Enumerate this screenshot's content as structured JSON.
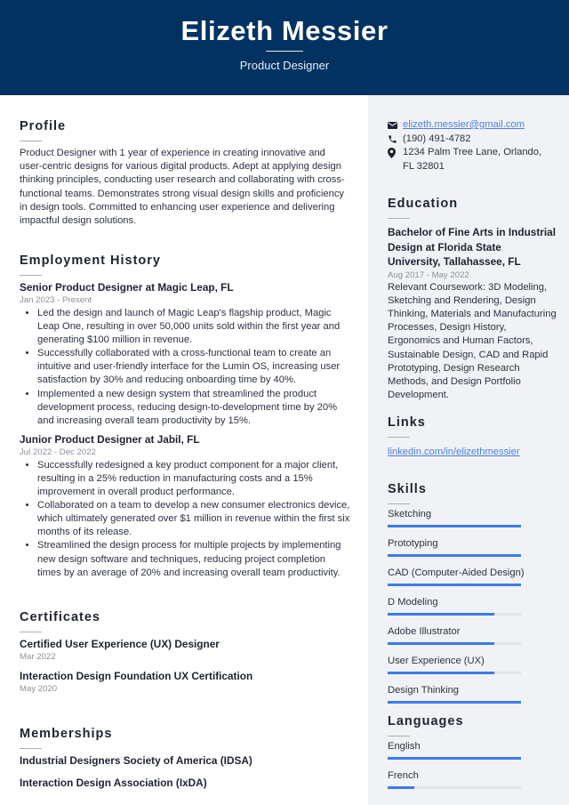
{
  "header": {
    "name": "Elizeth Messier",
    "title": "Product Designer"
  },
  "profile": {
    "heading": "Profile",
    "text": "Product Designer with 1 year of experience in creating innovative and user-centric designs for various digital products. Adept at applying design thinking principles, conducting user research and collaborating with cross-functional teams. Demonstrates strong visual design skills and proficiency in design tools. Committed to enhancing user experience and delivering impactful design solutions."
  },
  "employment": {
    "heading": "Employment History",
    "jobs": [
      {
        "title": "Senior Product Designer at Magic Leap, FL",
        "dates": "Jan 2023 - Present",
        "bullets": [
          "Led the design and launch of Magic Leap's flagship product, Magic Leap One, resulting in over 50,000 units sold within the first year and generating $100 million in revenue.",
          "Successfully collaborated with a cross-functional team to create an intuitive and user-friendly interface for the Lumin OS, increasing user satisfaction by 30% and reducing onboarding time by 40%.",
          "Implemented a new design system that streamlined the product development process, reducing design-to-development time by 20% and increasing overall team productivity by 15%."
        ]
      },
      {
        "title": "Junior Product Designer at Jabil, FL",
        "dates": "Jul 2022 - Dec 2022",
        "bullets": [
          "Successfully redesigned a key product component for a major client, resulting in a 25% reduction in manufacturing costs and a 15% improvement in overall product performance.",
          "Collaborated on a team to develop a new consumer electronics device, which ultimately generated over $1 million in revenue within the first six months of its release.",
          "Streamlined the design process for multiple projects by implementing new design software and techniques, reducing project completion times by an average of 20% and increasing overall team productivity."
        ]
      }
    ]
  },
  "certificates": {
    "heading": "Certificates",
    "items": [
      {
        "name": "Certified User Experience (UX) Designer",
        "date": "Mar 2022"
      },
      {
        "name": "Interaction Design Foundation UX Certification",
        "date": "May 2020"
      }
    ]
  },
  "memberships": {
    "heading": "Memberships",
    "items": [
      "Industrial Designers Society of America (IDSA)",
      "Interaction Design Association (IxDA)"
    ]
  },
  "contact": {
    "email": "elizeth.messier@gmail.com",
    "phone": "(190) 491-4782",
    "address": "1234 Palm Tree Lane, Orlando, FL 32801",
    "icons": {
      "email": "envelope-icon",
      "phone": "phone-icon",
      "address": "map-pin-icon"
    }
  },
  "education": {
    "heading": "Education",
    "degree": "Bachelor of Fine Arts in Industrial Design at Florida State University, Tallahassee, FL",
    "dates": "Aug 2017 - May 2022",
    "description": "Relevant Coursework: 3D Modeling, Sketching and Rendering, Design Thinking, Materials and Manufacturing Processes, Design History, Ergonomics and Human Factors, Sustainable Design, CAD and Rapid Prototyping, Design Research Methods, and Design Portfolio Development."
  },
  "links": {
    "heading": "Links",
    "items": [
      "linkedin.com/in/elizethmessier"
    ]
  },
  "skills": {
    "heading": "Skills",
    "items": [
      {
        "name": "Sketching",
        "level": 1.0
      },
      {
        "name": "Prototyping",
        "level": 1.0
      },
      {
        "name": "CAD (Computer-Aided Design)",
        "level": 1.0
      },
      {
        "name": "D Modeling",
        "level": 0.8
      },
      {
        "name": "Adobe Illustrator",
        "level": 0.8
      },
      {
        "name": "User Experience (UX)",
        "level": 0.8
      },
      {
        "name": "Design Thinking",
        "level": 1.0
      }
    ]
  },
  "languages": {
    "heading": "Languages",
    "items": [
      {
        "name": "English",
        "level": 1.0
      },
      {
        "name": "French",
        "level": 0.2
      }
    ]
  },
  "colors": {
    "header_bg": "#023262",
    "sidebar_bg": "#f1f2f5",
    "accent": "#3b7be6",
    "link": "#4a7fe0"
  }
}
